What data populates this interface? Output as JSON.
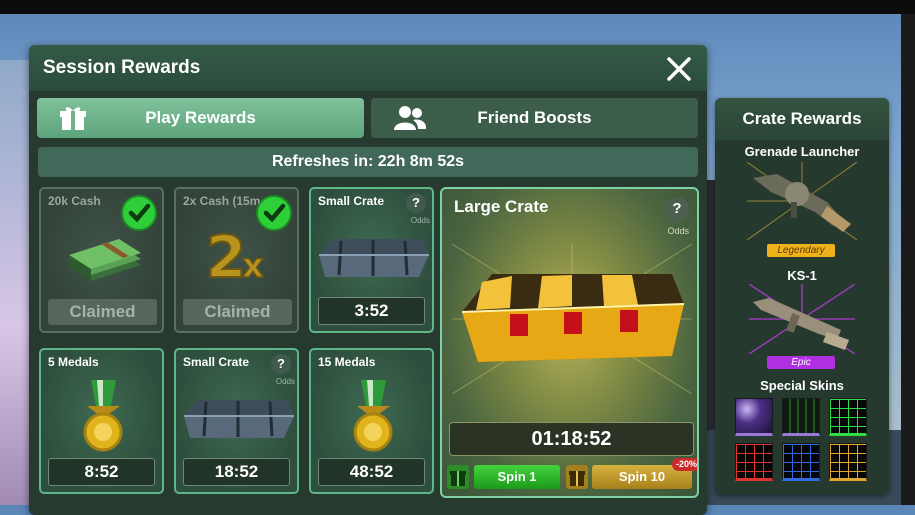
{
  "header": {
    "title": "Session Rewards"
  },
  "tabs": [
    {
      "label": "Play Rewards",
      "active": true,
      "icon": "gift-icon"
    },
    {
      "label": "Friend Boosts",
      "active": false,
      "icon": "friends-icon"
    }
  ],
  "refresh": {
    "text": "Refreshes in: 22h 8m 52s"
  },
  "rewards": [
    {
      "title": "20k Cash",
      "status": "Claimed",
      "icon": "cash-stack-icon"
    },
    {
      "title": "2x Cash (15m",
      "status": "Claimed",
      "icon": "double-cash-icon"
    },
    {
      "title": "Small Crate",
      "timer": "3:52",
      "odds": "Odds",
      "icon": "crate-icon"
    },
    {
      "title": "5 Medals",
      "timer": "8:52",
      "icon": "medal-icon"
    },
    {
      "title": "Small Crate",
      "timer": "18:52",
      "odds": "Odds",
      "icon": "crate-icon"
    },
    {
      "title": "15 Medals",
      "timer": "48:52",
      "icon": "medal-icon"
    }
  ],
  "large_crate": {
    "title": "Large Crate",
    "odds": "Odds",
    "timer": "01:18:52",
    "spin1": "Spin 1",
    "spin10": "Spin 10",
    "discount": "-20%"
  },
  "crate_rewards": {
    "title": "Crate Rewards",
    "items": [
      {
        "name": "Grenade Launcher",
        "rarity": "Legendary",
        "color": "#f0b21a"
      },
      {
        "name": "KS-1",
        "rarity": "Epic",
        "color": "#b02fe0"
      }
    ],
    "skins_label": "Special Skins",
    "skins": [
      "#9a7ad6",
      "#29c23b",
      "#2fdc42",
      "#e0322f",
      "#2f6ae0",
      "#e0a52f"
    ]
  },
  "colors": {
    "accent_green": "#5fb688",
    "spin_green": "#2fb52a",
    "spin_gold": "#c79b2c"
  }
}
